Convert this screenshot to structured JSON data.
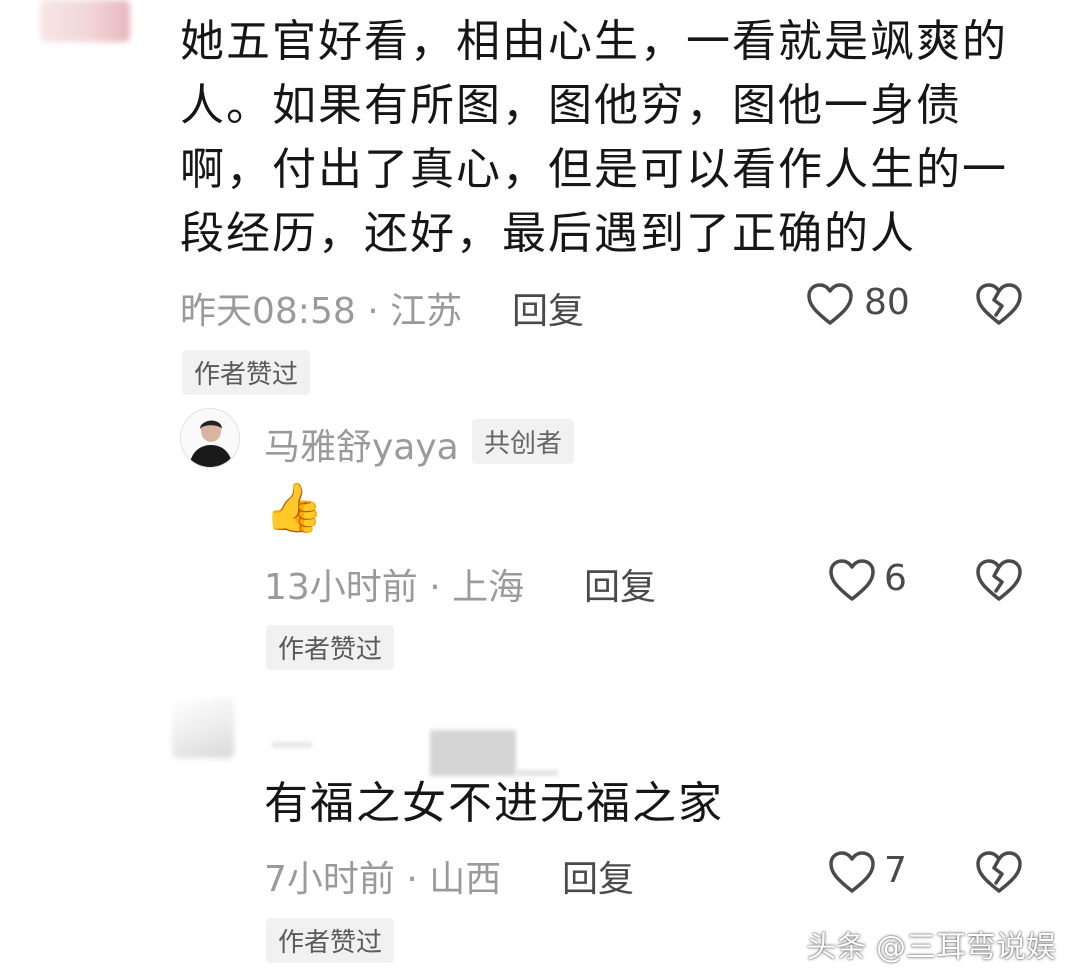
{
  "comments": [
    {
      "text": "她五官好看，相由心生，一看就是飒爽的人。如果有所图，图他穷，图他一身债啊，付出了真心，但是可以看作人生的一段经历，还好，最后遇到了正确的人",
      "lines": [
        "她五官好看，相由心生，一看就是飒爽的",
        "人。如果有所图，图他穷，图他一身债",
        "啊，付出了真心，但是可以看作人生的一",
        "段经历，还好，最后遇到了正确的人"
      ],
      "meta": "昨天08:58 · 江苏",
      "reply_label": "回复",
      "likes": "80",
      "badge": "作者赞过"
    },
    {
      "user": "马雅舒yaya",
      "role_badge": "共创者",
      "text": "👍",
      "meta": "13小时前 · 上海",
      "reply_label": "回复",
      "likes": "6",
      "badge": "作者赞过"
    },
    {
      "text": "有福之女不进无福之家",
      "meta": "7小时前 · 山西",
      "reply_label": "回复",
      "likes": "7",
      "badge": "作者赞过"
    }
  ],
  "watermark": "头条 @三耳弯说娱",
  "icons": {
    "like": "heart-outline-icon",
    "dislike": "broken-heart-icon"
  },
  "colors": {
    "text": "#161616",
    "meta": "#9a9a9a",
    "badge_bg": "#f1f1f1"
  }
}
